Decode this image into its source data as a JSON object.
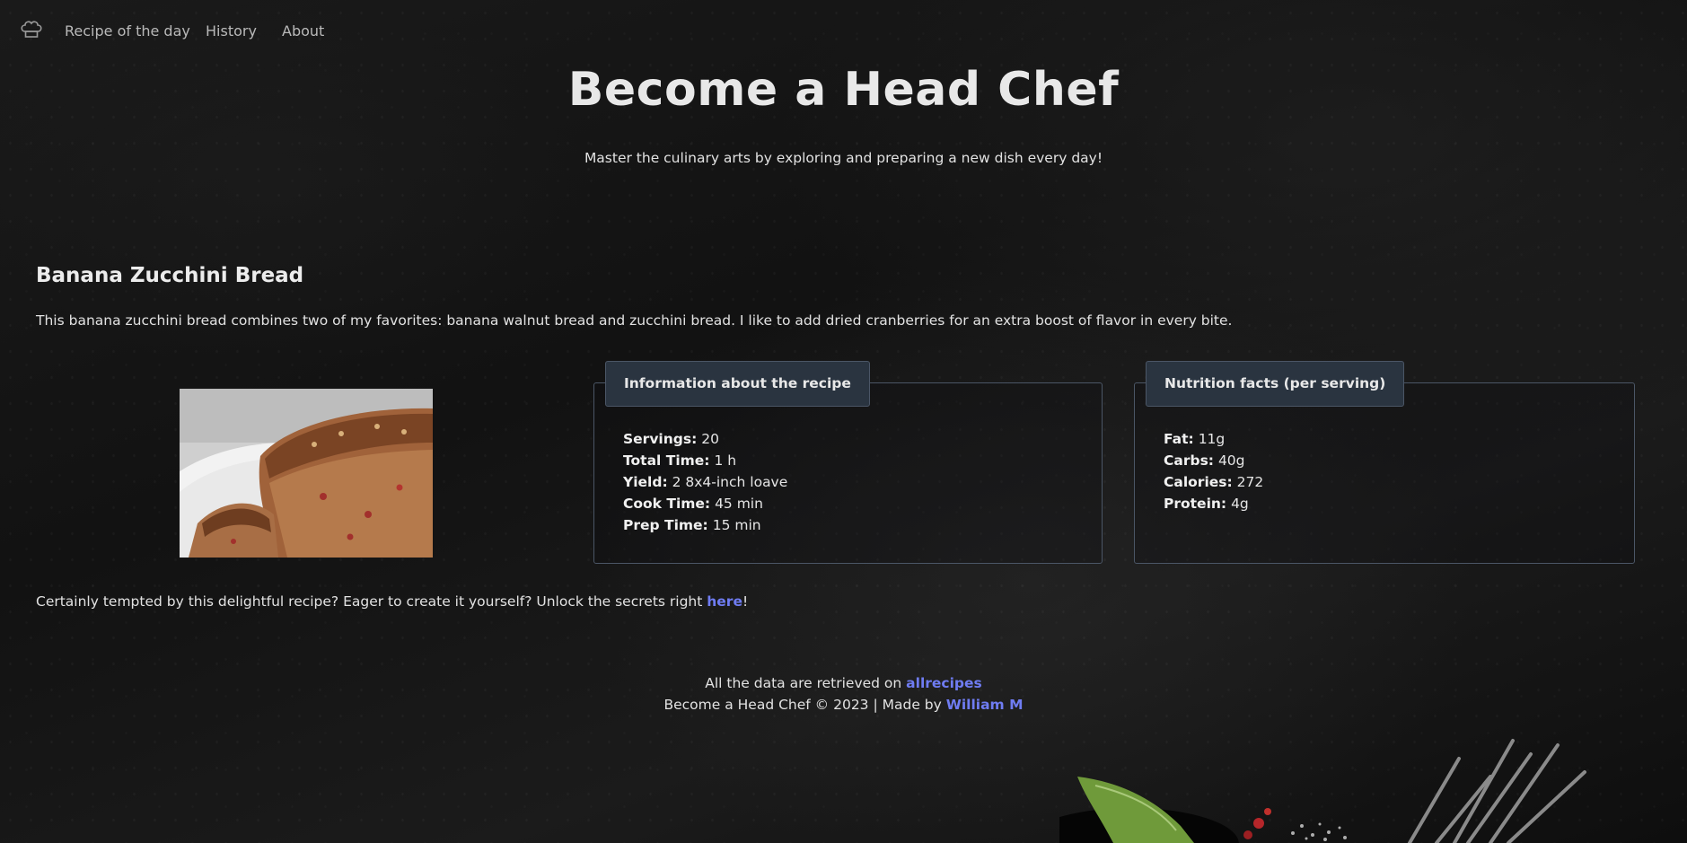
{
  "nav": {
    "logo_icon": "chef-hat-icon",
    "links": [
      {
        "label": "Recipe of the day"
      },
      {
        "label": "History"
      },
      {
        "label": "About"
      }
    ]
  },
  "hero": {
    "title": "Become a Head Chef",
    "subtitle": "Master the culinary arts by exploring and preparing a new dish every day!"
  },
  "recipe": {
    "title": "Banana Zucchini Bread",
    "description": "This banana zucchini bread combines two of my favorites: banana walnut bread and zucchini bread. I like to add dried cranberries for an extra boost of flavor in every bite.",
    "info_card": {
      "header": "Information about the recipe",
      "items": [
        {
          "label": "Servings:",
          "value": "20"
        },
        {
          "label": "Total Time:",
          "value": "1 h"
        },
        {
          "label": "Yield:",
          "value": "2 8x4-inch loave"
        },
        {
          "label": "Cook Time:",
          "value": "45 min"
        },
        {
          "label": "Prep Time:",
          "value": "15 min"
        }
      ]
    },
    "nutrition_card": {
      "header": "Nutrition facts (per serving)",
      "items": [
        {
          "label": "Fat:",
          "value": "11g"
        },
        {
          "label": "Carbs:",
          "value": "40g"
        },
        {
          "label": "Calories:",
          "value": "272"
        },
        {
          "label": "Protein:",
          "value": "4g"
        }
      ]
    },
    "cta": {
      "before": "Certainly tempted by this delightful recipe? Eager to create it yourself? Unlock the secrets right ",
      "link_label": "here",
      "after": "!"
    }
  },
  "footer": {
    "line1_before": "All the data are retrieved on ",
    "line1_link": "allrecipes",
    "line2_before": "Become a Head Chef © 2023 | Made by ",
    "line2_link": "William M"
  },
  "colors": {
    "link": "#6f7cf2",
    "card_header_bg": "#2a3440",
    "card_border": "#4b5666"
  }
}
